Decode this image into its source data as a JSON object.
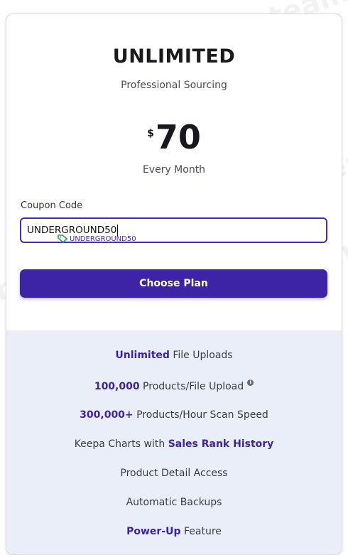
{
  "plan": {
    "title": "UNLIMITED",
    "subtitle": "Professional Sourcing",
    "currency": "$",
    "price": "70",
    "period": "Every Month"
  },
  "coupon": {
    "label": "Coupon Code",
    "value": "UNDERGROUND50",
    "applied_tag": "UNDERGROUND50"
  },
  "cta": {
    "label": "Choose Plan"
  },
  "features": [
    {
      "highlight": "Unlimited",
      "text": " File Uploads"
    },
    {
      "highlight": "100,000",
      "text": " Products/File Upload"
    },
    {
      "highlight": "300,000+",
      "text": " Products/Hour Scan Speed"
    },
    {
      "prefix": "Keepa Charts with ",
      "highlight": "Sales Rank History"
    },
    {
      "text": "Product Detail Access"
    },
    {
      "text": "Automatic Backups"
    },
    {
      "highlight": "Power-Up",
      "text": " Feature"
    }
  ],
  "watermark": "Tenereteam",
  "colors": {
    "accent": "#3d23a6",
    "feature_bg": "#e9eef8"
  }
}
